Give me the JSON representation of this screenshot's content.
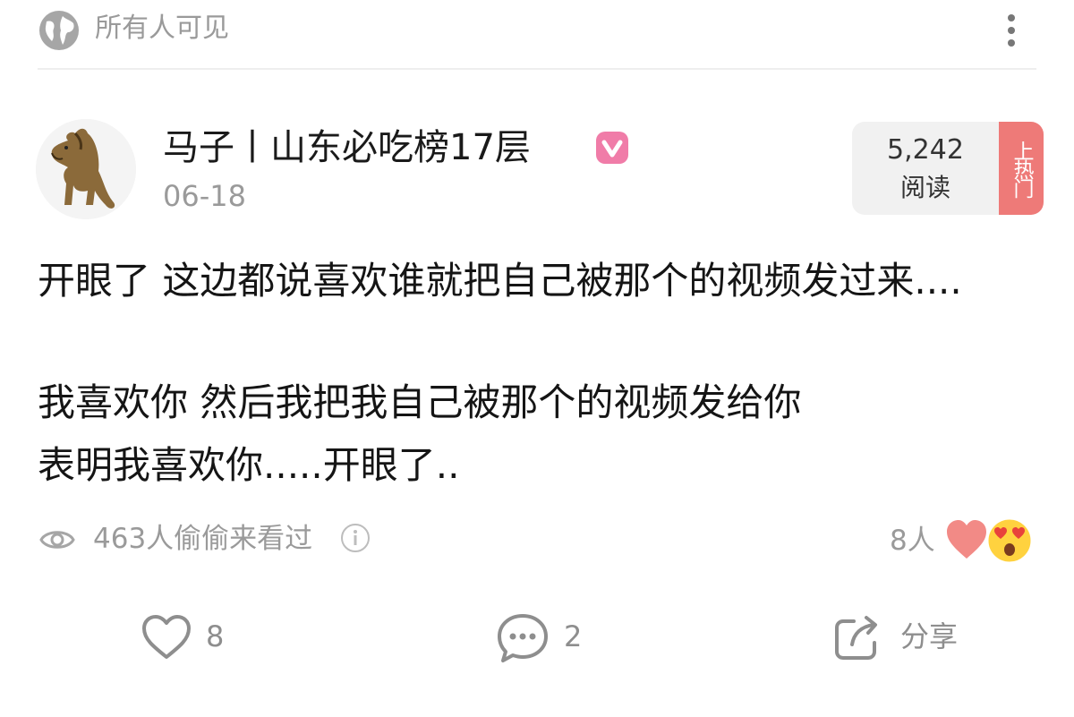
{
  "visibility": {
    "label": "所有人可见",
    "icon": "globe-icon"
  },
  "author": {
    "name": "马子丨山东必吃榜17层",
    "date": "06-18",
    "verified_badge": "v",
    "badge_color": "#f07ca8"
  },
  "stats_badge": {
    "count": "5,242",
    "label": "阅读",
    "hot_tag": "上热门",
    "hot_color": "#ee7a78"
  },
  "post": {
    "lines": [
      "开眼了 这边都说喜欢谁就把自己被那个的视频发过来....",
      "我喜欢你 然后我把我自己被那个的视频发给你",
      "表明我喜欢你.....开眼了.."
    ]
  },
  "views": {
    "text": "463人偷偷来看过"
  },
  "reactions": {
    "text": "8人",
    "icons": [
      "heart-emoji",
      "heart-eyes-emoji"
    ]
  },
  "actions": {
    "like_count": "8",
    "comment_count": "2",
    "share_label": "分享"
  }
}
